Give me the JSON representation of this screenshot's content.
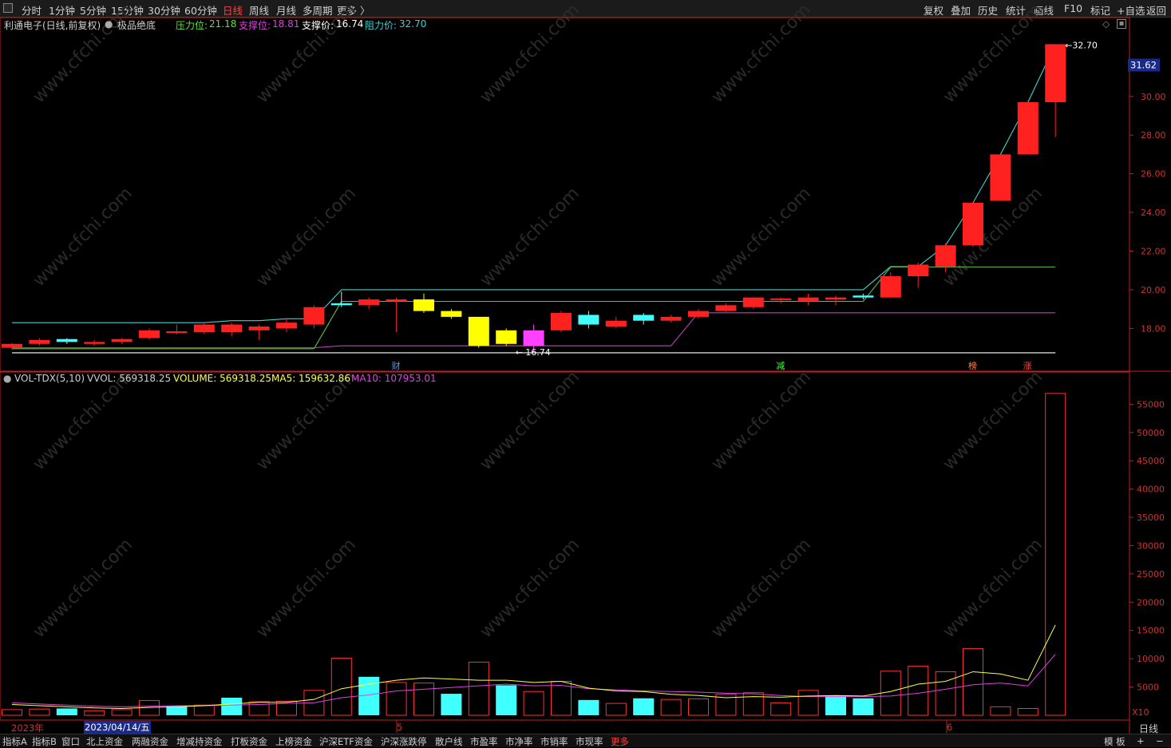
{
  "periods": [
    "分时",
    "1分钟",
    "5分钟",
    "15分钟",
    "30分钟",
    "60分钟",
    "日线",
    "周线",
    "月线",
    "多周期",
    "更多 〉"
  ],
  "active_period": "日线",
  "right_toolbar": [
    "复权",
    "叠加",
    "历史",
    "统计",
    "画线",
    "F10",
    "标记",
    "+自选",
    "返回"
  ],
  "header": {
    "stock_title": "利通电子(日线,前复权)",
    "indicator_name": "极品绝底",
    "pressure_label": "压力位:",
    "pressure_value": "21.18",
    "support_label": "支撑位:",
    "support_value": "18.81",
    "support_price_label": "支撑价:",
    "support_price_value": "16.74",
    "resist_price_label": "阻力价:",
    "resist_price_value": "32.70"
  },
  "colors": {
    "up": "#ff2020",
    "down_cyan": "#40ffff",
    "yellow": "#ffff00",
    "magenta": "#ff40ff",
    "resist_line": "#40d0d0",
    "support_line": "#c040c0",
    "pressure_line": "#60c040",
    "white_line": "#ffffff",
    "axis": "#c02020"
  },
  "price_axis": {
    "labels": [
      "30.00",
      "28.00",
      "26.00",
      "24.00",
      "22.00",
      "20.00",
      "18.00"
    ],
    "current": "31.62",
    "high_mark": "32.70",
    "low_mark": "16.74"
  },
  "events": [
    {
      "label": "财",
      "color": "#40a0ff"
    },
    {
      "label": "减",
      "color": "#40ff40"
    },
    {
      "label": "榜",
      "color": "#ff8040"
    },
    {
      "label": "涨",
      "color": "#ff4040"
    }
  ],
  "volume_header": {
    "name": "VOL-TDX(5,10)",
    "vvol": "VVOL: 569318.25",
    "volume": "VOLUME: 569318.25",
    "ma5": "MA5: 159632.86",
    "ma10": "MA10: 107953.01"
  },
  "volume_axis": {
    "labels": [
      "55000",
      "50000",
      "45000",
      "40000",
      "35000",
      "30000",
      "25000",
      "20000",
      "15000",
      "10000",
      "5000"
    ],
    "unit": "X10"
  },
  "date_axis": {
    "year": "2023年",
    "current_date": "2023/04/14/五",
    "month5": "5",
    "month6": "6",
    "period_label": "日线"
  },
  "bottom_tabs": [
    "指标A",
    "指标B",
    "窗口",
    "北上资金",
    "两融资金",
    "增减持资金",
    "打板资金",
    "上榜资金",
    "沪深ETF资金",
    "沪深涨跌停",
    "散户线",
    "市盈率",
    "市净率",
    "市销率",
    "市现率",
    "更多"
  ],
  "bottom_right": [
    "模 板",
    "+",
    "−"
  ],
  "watermark": "www.cfchi.com",
  "chart_data": {
    "type": "candlestick",
    "candles": [
      {
        "o": 17.0,
        "c": 17.2,
        "h": 17.25,
        "l": 16.9,
        "t": "up"
      },
      {
        "o": 17.2,
        "c": 17.4,
        "h": 17.5,
        "l": 17.1,
        "t": "up"
      },
      {
        "o": 17.3,
        "c": 17.45,
        "h": 17.5,
        "l": 17.2,
        "t": "cyan"
      },
      {
        "o": 17.2,
        "c": 17.3,
        "h": 17.4,
        "l": 17.1,
        "t": "up"
      },
      {
        "o": 17.3,
        "c": 17.45,
        "h": 17.5,
        "l": 17.2,
        "t": "up"
      },
      {
        "o": 17.5,
        "c": 17.9,
        "h": 18.0,
        "l": 17.4,
        "t": "up"
      },
      {
        "o": 17.8,
        "c": 17.85,
        "h": 18.2,
        "l": 17.7,
        "t": "up"
      },
      {
        "o": 17.8,
        "c": 18.2,
        "h": 18.3,
        "l": 17.7,
        "t": "up"
      },
      {
        "o": 18.2,
        "c": 17.8,
        "h": 18.3,
        "l": 17.6,
        "t": "up"
      },
      {
        "o": 17.9,
        "c": 18.1,
        "h": 18.2,
        "l": 17.4,
        "t": "up"
      },
      {
        "o": 18.0,
        "c": 18.3,
        "h": 18.5,
        "l": 17.8,
        "t": "up"
      },
      {
        "o": 18.2,
        "c": 19.1,
        "h": 19.2,
        "l": 18.0,
        "t": "up"
      },
      {
        "o": 19.3,
        "c": 19.2,
        "h": 19.9,
        "l": 19.1,
        "t": "cyan"
      },
      {
        "o": 19.2,
        "c": 19.5,
        "h": 19.6,
        "l": 19.0,
        "t": "up"
      },
      {
        "o": 19.4,
        "c": 19.5,
        "h": 19.6,
        "l": 17.8,
        "t": "up"
      },
      {
        "o": 19.5,
        "c": 18.9,
        "h": 19.8,
        "l": 18.8,
        "t": "yellow"
      },
      {
        "o": 18.9,
        "c": 18.6,
        "h": 19.0,
        "l": 18.5,
        "t": "yellow"
      },
      {
        "o": 18.6,
        "c": 17.1,
        "h": 18.6,
        "l": 17.0,
        "t": "yellow"
      },
      {
        "o": 17.9,
        "c": 17.2,
        "h": 18.0,
        "l": 17.1,
        "t": "yellow"
      },
      {
        "o": 17.1,
        "c": 17.9,
        "h": 18.2,
        "l": 16.74,
        "t": "magenta"
      },
      {
        "o": 17.9,
        "c": 18.8,
        "h": 18.9,
        "l": 17.8,
        "t": "up"
      },
      {
        "o": 18.7,
        "c": 18.2,
        "h": 18.9,
        "l": 18.0,
        "t": "cyan"
      },
      {
        "o": 18.1,
        "c": 18.4,
        "h": 18.6,
        "l": 18.0,
        "t": "up"
      },
      {
        "o": 18.7,
        "c": 18.4,
        "h": 18.8,
        "l": 18.2,
        "t": "cyan"
      },
      {
        "o": 18.4,
        "c": 18.6,
        "h": 18.7,
        "l": 18.3,
        "t": "up"
      },
      {
        "o": 18.6,
        "c": 18.9,
        "h": 19.0,
        "l": 18.5,
        "t": "up"
      },
      {
        "o": 18.9,
        "c": 19.2,
        "h": 19.3,
        "l": 18.8,
        "t": "up"
      },
      {
        "o": 19.1,
        "c": 19.6,
        "h": 19.6,
        "l": 19.0,
        "t": "up"
      },
      {
        "o": 19.5,
        "c": 19.55,
        "h": 19.6,
        "l": 19.3,
        "t": "up"
      },
      {
        "o": 19.4,
        "c": 19.6,
        "h": 19.8,
        "l": 19.2,
        "t": "up"
      },
      {
        "o": 19.5,
        "c": 19.6,
        "h": 19.7,
        "l": 19.2,
        "t": "up"
      },
      {
        "o": 19.7,
        "c": 19.6,
        "h": 19.8,
        "l": 19.5,
        "t": "cyan"
      },
      {
        "o": 19.6,
        "c": 20.7,
        "h": 20.9,
        "l": 19.6,
        "t": "up"
      },
      {
        "o": 20.7,
        "c": 21.3,
        "h": 21.4,
        "l": 20.1,
        "t": "up"
      },
      {
        "o": 21.2,
        "c": 22.3,
        "h": 22.4,
        "l": 20.9,
        "t": "up"
      },
      {
        "o": 22.3,
        "c": 24.5,
        "h": 24.5,
        "l": 22.2,
        "t": "up"
      },
      {
        "o": 24.6,
        "c": 27.0,
        "h": 27.0,
        "l": 24.6,
        "t": "up"
      },
      {
        "o": 27.0,
        "c": 29.7,
        "h": 29.7,
        "l": 27.0,
        "t": "up"
      },
      {
        "o": 29.7,
        "c": 32.7,
        "h": 32.7,
        "l": 27.9,
        "t": "up"
      }
    ],
    "volumes": [
      1000,
      1100,
      1200,
      800,
      1000,
      2600,
      1600,
      1800,
      3100,
      2400,
      2500,
      4400,
      10100,
      6800,
      5800,
      5700,
      3800,
      9400,
      5300,
      4200,
      6000,
      2700,
      2100,
      3000,
      2800,
      2900,
      3700,
      4000,
      2200,
      4400,
      3500,
      3000,
      7800,
      8700,
      7700,
      11800,
      1500,
      1200,
      56900
    ],
    "vol_types": [
      "up",
      "up",
      "cyan",
      "up",
      "up",
      "up",
      "cyan",
      "up",
      "cyan",
      "up",
      "up",
      "up",
      "up",
      "cyan",
      "up",
      "up",
      "cyan",
      "up",
      "cyan",
      "up",
      "up",
      "cyan",
      "up",
      "cyan",
      "up",
      "up",
      "up",
      "up",
      "up",
      "up",
      "cyan",
      "cyan",
      "up",
      "up",
      "up",
      "up",
      "up",
      "up",
      "up"
    ],
    "ma5": [
      1900,
      1700,
      1500,
      1300,
      1200,
      1400,
      1500,
      1700,
      2000,
      2300,
      2300,
      2800,
      4700,
      5500,
      6200,
      6600,
      6400,
      6200,
      6200,
      5800,
      6000,
      4800,
      4300,
      4200,
      3700,
      3500,
      3100,
      3300,
      3200,
      3400,
      3500,
      3400,
      4200,
      5500,
      6000,
      7700,
      7300,
      6200,
      15963
    ],
    "ma10": [
      2200,
      2000,
      1800,
      1600,
      1500,
      1600,
      1700,
      1700,
      1800,
      1900,
      2100,
      2200,
      3100,
      3600,
      4300,
      4600,
      4900,
      5200,
      5500,
      5200,
      5300,
      4700,
      4500,
      4300,
      4200,
      4100,
      3900,
      3800,
      3500,
      3300,
      3300,
      3300,
      3400,
      3900,
      4600,
      5400,
      5700,
      5200,
      10795
    ],
    "resist_line": [
      18.3,
      18.3,
      18.3,
      18.3,
      18.3,
      18.3,
      18.3,
      18.3,
      18.4,
      18.4,
      18.5,
      18.5,
      20.0,
      20.0,
      20.0,
      20.0,
      20.0,
      20.0,
      20.0,
      20.0,
      20.0,
      20.0,
      20.0,
      20.0,
      20.0,
      20.0,
      20.0,
      20.0,
      20.0,
      20.0,
      20.0,
      20.0,
      21.2,
      21.2,
      22.3,
      24.5,
      27.0,
      29.7,
      32.7
    ],
    "pressure_line": [
      16.95,
      16.95,
      16.95,
      16.95,
      16.95,
      16.95,
      16.95,
      16.95,
      16.95,
      16.95,
      16.95,
      16.95,
      19.4,
      19.4,
      19.4,
      19.4,
      19.4,
      19.4,
      19.4,
      19.4,
      19.4,
      19.4,
      19.4,
      19.4,
      19.4,
      19.4,
      19.4,
      19.4,
      19.4,
      19.4,
      19.4,
      19.4,
      21.18,
      21.18,
      21.18,
      21.18,
      21.18,
      21.18,
      21.18
    ],
    "support_line": [
      17.0,
      17.0,
      17.0,
      17.0,
      17.0,
      17.0,
      17.0,
      17.0,
      17.0,
      17.0,
      17.0,
      17.0,
      17.1,
      17.1,
      17.1,
      17.1,
      17.1,
      17.1,
      17.1,
      17.1,
      17.1,
      17.1,
      17.1,
      17.1,
      17.1,
      18.81,
      18.81,
      18.81,
      18.81,
      18.81,
      18.81,
      18.81,
      18.81,
      18.81,
      18.81,
      18.81,
      18.81,
      18.81,
      18.81
    ],
    "white_line": [
      16.74,
      16.74,
      16.74,
      16.74,
      16.74,
      16.74,
      16.74,
      16.74,
      16.74,
      16.74,
      16.74,
      16.74,
      16.74,
      16.74,
      16.74,
      16.74,
      16.74,
      16.74,
      16.74,
      16.74,
      16.74,
      16.74,
      16.74,
      16.74,
      16.74,
      16.74,
      16.74,
      16.74,
      16.74,
      16.74,
      16.74,
      16.74,
      16.74,
      16.74,
      16.74,
      16.74,
      16.74,
      16.74,
      16.74
    ],
    "price_range": [
      16.2,
      33.5
    ],
    "volume_range": [
      0,
      59000
    ]
  }
}
